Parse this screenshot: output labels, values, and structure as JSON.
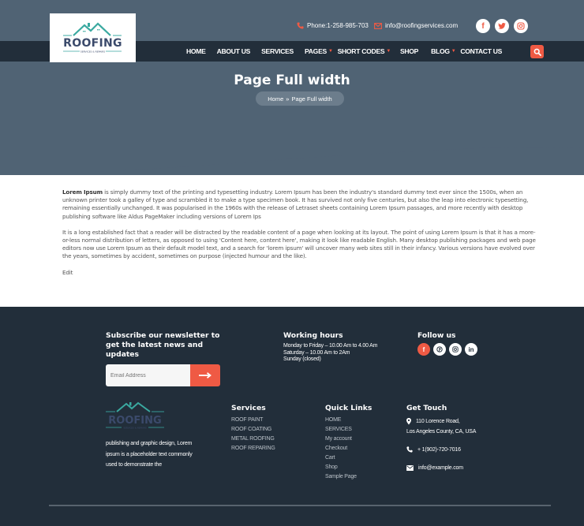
{
  "brand": {
    "logo_text": "ROOFING",
    "logo_tagline": "SERVICES & REPAIRS"
  },
  "topbar": {
    "phone": "Phone:1-258-985-703",
    "email": "info@roofingservices.com",
    "social": [
      {
        "icon": "facebook-icon",
        "glyph": "f"
      },
      {
        "icon": "twitter-icon",
        "glyph": "t"
      },
      {
        "icon": "instagram-icon",
        "glyph": "◎"
      }
    ]
  },
  "nav": {
    "items": [
      {
        "label": "HOME",
        "dropdown": false
      },
      {
        "label": "ABOUT US",
        "dropdown": false
      },
      {
        "label": "SERVICES",
        "dropdown": false
      },
      {
        "label": "PAGES",
        "dropdown": true
      },
      {
        "label": "SHORT CODES",
        "dropdown": true
      },
      {
        "label": "SHOP",
        "dropdown": false
      },
      {
        "label": "BLOG",
        "dropdown": true
      },
      {
        "label": "CONTACT US",
        "dropdown": false
      }
    ],
    "search_icon": "search-icon"
  },
  "hero": {
    "title": "Page Full width",
    "breadcrumb": {
      "home": "Home",
      "separator": "»",
      "current": "Page Full width"
    }
  },
  "content": {
    "p1_lead": "Lorem Ipsum",
    "p1": " is simply dummy text of the printing and typesetting industry. Lorem Ipsum has been the industry's standard dummy text ever since the 1500s, when an unknown printer took a galley of type and scrambled it to make a type specimen book. It has survived not only five centuries, but also the leap into electronic typesetting, remaining essentially unchanged. It was popularised in the 1960s with the release of Letraset sheets containing Lorem Ipsum passages, and more recently with desktop publishing software like Aldus PageMaker including versions of Lorem Ips",
    "p2": "It is a long established fact that a reader will be distracted by the readable content of a page when looking at its layout. The point of using Lorem Ipsum is that it has a more-or-less normal distribution of letters, as opposed to using 'Content here, content here', making it look like readable English. Many desktop publishing packages and web page editors now use Lorem Ipsum as their default model text, and a search for 'lorem ipsum' will uncover many web sites still in their infancy. Various versions have evolved over the years, sometimes by accident, sometimes on purpose (injected humour and the like).",
    "edit_label": "Edit"
  },
  "footer": {
    "newsletter": {
      "heading": "Subscribe our newsletter to get the latest news and updates",
      "email_placeholder": "Email Address",
      "submit_icon": "arrow-right-icon"
    },
    "hours": {
      "heading": "Working hours",
      "lines": [
        "Monday to Friday – 10.00 Am to 4.00 Am",
        "Saturday – 10.00 Am to  2Am",
        "Sunday (closed)"
      ]
    },
    "follow": {
      "heading": "Follow us",
      "social": [
        {
          "icon": "facebook-icon",
          "glyph": "f"
        },
        {
          "icon": "pinterest-icon",
          "glyph": "℗"
        },
        {
          "icon": "instagram-icon",
          "glyph": "◎"
        },
        {
          "icon": "linkedin-icon",
          "glyph": "in"
        }
      ]
    },
    "about": "publishing and graphic design, Lorem ipsum is a placeholder text commonly used to demonstrate the",
    "services": {
      "heading": "Services",
      "items": [
        "ROOF PAINT",
        "ROOF COATING",
        "METAL ROOFING",
        "ROOF REPARING"
      ]
    },
    "quick_links": {
      "heading": "Quick Links",
      "items": [
        "HOME",
        "SERVICES",
        "My account",
        "Checkout",
        "Cart",
        "Shop",
        "Sample Page"
      ]
    },
    "touch": {
      "heading": "Get Touch",
      "address_line1": "110 Lorence Road,",
      "address_line2": "Los Angeles County, CA, USA",
      "phone": "+ 1(902)-720-7016",
      "email": "info@example.com"
    }
  },
  "colors": {
    "accent": "#ef5a44",
    "hero_bg": "#506374",
    "nav_bg": "#222e3a",
    "footer_bg": "#222e3a",
    "logo_teal": "#3aa9a0",
    "logo_navy": "#3b4a6b"
  }
}
